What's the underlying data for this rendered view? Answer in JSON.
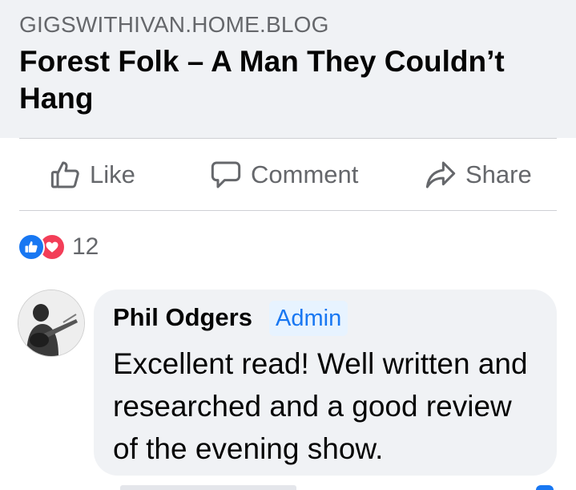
{
  "link_preview": {
    "domain": "GIGSWITHIVAN.HOME.BLOG",
    "title": "Forest Folk – A Man They Couldn’t Hang"
  },
  "actions": {
    "like_label": "Like",
    "comment_label": "Comment",
    "share_label": "Share"
  },
  "reactions": {
    "count": "12",
    "types": [
      "like",
      "love"
    ]
  },
  "comment": {
    "author": "Phil Odgers",
    "badge": "Admin",
    "text": "Excellent read! Well written and researched and a good review of the evening show."
  },
  "colors": {
    "accent": "#1877f2",
    "love": "#f33e58",
    "muted_text": "#65676b",
    "card_bg": "#f0f2f5"
  }
}
